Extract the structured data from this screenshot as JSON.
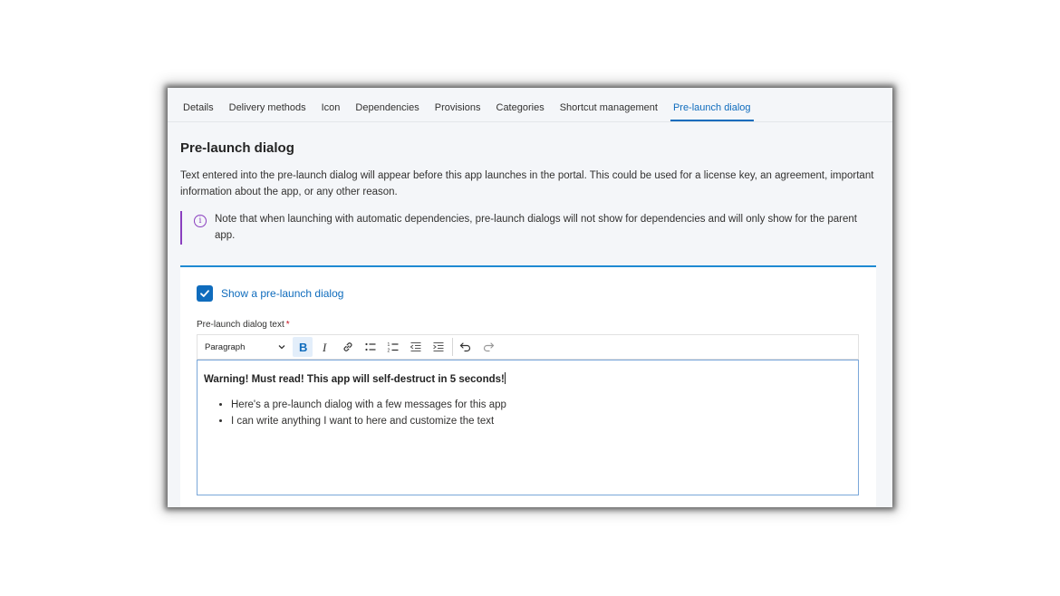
{
  "tabs": [
    {
      "label": "Details"
    },
    {
      "label": "Delivery methods"
    },
    {
      "label": "Icon"
    },
    {
      "label": "Dependencies"
    },
    {
      "label": "Provisions"
    },
    {
      "label": "Categories"
    },
    {
      "label": "Shortcut management"
    },
    {
      "label": "Pre-launch dialog",
      "active": true
    }
  ],
  "page": {
    "title": "Pre-launch dialog",
    "description": "Text entered into the pre-launch dialog will appear before this app launches in the portal. This could be used for a license key, an agreement, important information about the app, or any other reason.",
    "note": "Note that when launching with automatic dependencies, pre-launch dialogs will not show for dependencies and will only show for the parent app.",
    "note_icon": "info-icon"
  },
  "form": {
    "show_dialog_label": "Show a pre-launch dialog",
    "show_dialog_checked": true,
    "text_label": "Pre-launch dialog text",
    "required_marker": "*"
  },
  "toolbar": {
    "format_select": "Paragraph",
    "buttons": [
      "bold-icon",
      "italic-icon",
      "link-icon",
      "bulleted-list-icon",
      "numbered-list-icon",
      "decrease-indent-icon",
      "increase-indent-icon",
      "undo-icon",
      "redo-icon"
    ]
  },
  "editor": {
    "heading": "Warning! Must read! This app will self-destruct in 5 seconds!",
    "bullets": [
      "Here's a pre-launch dialog with a few messages for this app",
      "I can write anything I want to here and customize the text"
    ]
  },
  "colors": {
    "accent": "#0f6cbd",
    "note_border": "#8a3fbf",
    "required": "#c50f1f"
  }
}
